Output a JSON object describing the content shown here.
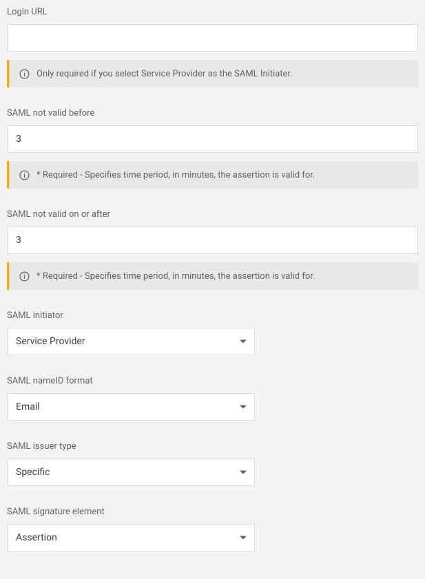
{
  "fields": {
    "login_url": {
      "label": "Login URL",
      "value": "",
      "hint": "Only required if you select Service Provider as the SAML Initiater."
    },
    "not_valid_before": {
      "label": "SAML not valid before",
      "value": "3",
      "hint": "* Required - Specifies time period, in minutes, the assertion is valid for."
    },
    "not_valid_on_after": {
      "label": "SAML not valid on or after",
      "value": "3",
      "hint": "* Required - Specifies time period, in minutes, the assertion is valid for."
    },
    "initiator": {
      "label": "SAML initiator",
      "value": "Service Provider"
    },
    "nameid_format": {
      "label": "SAML nameID format",
      "value": "Email"
    },
    "issuer_type": {
      "label": "SAML issuer type",
      "value": "Specific"
    },
    "signature_element": {
      "label": "SAML signature element",
      "value": "Assertion"
    }
  }
}
